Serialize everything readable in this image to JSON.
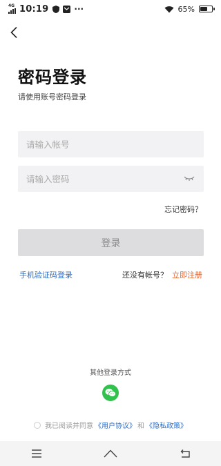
{
  "status_bar": {
    "network": "4G",
    "time": "10:19",
    "more": "···",
    "battery": "65%",
    "battery_level": 0.65
  },
  "page": {
    "title": "密码登录",
    "subtitle": "请使用账号密码登录"
  },
  "form": {
    "account_placeholder": "请输入帐号",
    "password_placeholder": "请输入密码",
    "forgot": "忘记密码？",
    "login_label": "登录"
  },
  "links": {
    "sms_login": "手机验证码登录",
    "no_account": "还没有帐号？",
    "register": "立即注册"
  },
  "other": {
    "label": "其他登录方式"
  },
  "agreement": {
    "prefix": "我已阅读并同意",
    "user_agreement": "《用户协议》",
    "and": "和",
    "privacy_policy": "《隐私政策》"
  },
  "colors": {
    "link_blue": "#2c6ec7",
    "register_orange": "#e8632d",
    "wechat_green": "#31c24d",
    "button_disabled": "#dddddf"
  }
}
